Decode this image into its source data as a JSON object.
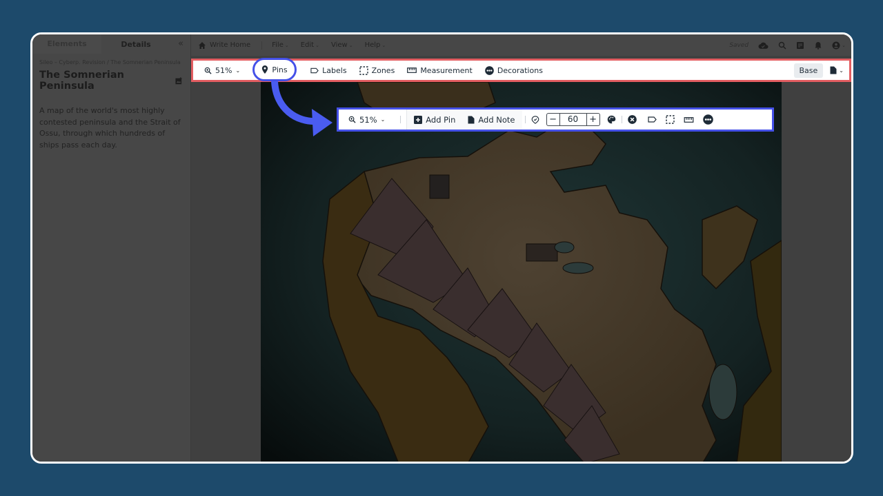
{
  "sidebar": {
    "tabs": [
      {
        "label": "Elements",
        "active": false
      },
      {
        "label": "Details",
        "active": true
      }
    ],
    "collapse_icon": "double-chevron-left-icon",
    "breadcrumb": "Sileo – Cyberp. Revision / The Somnerian Peninsula",
    "title": "The Somnerian Peninsula",
    "title_icon": "add-image-icon",
    "description": "A map of the world's most highly contested peninsula and the Strait of Ossu, through which hundreds of ships pass each day."
  },
  "menubar": {
    "home_label": "Write Home",
    "menus": [
      {
        "label": "File"
      },
      {
        "label": "Edit"
      },
      {
        "label": "View"
      },
      {
        "label": "Help"
      }
    ],
    "status": "Saved",
    "icons": [
      "cloud-check-icon",
      "search-icon",
      "notes-icon",
      "bell-icon",
      "account-icon"
    ]
  },
  "toolbar_main": {
    "zoom": "51%",
    "items": [
      {
        "label": "Pins",
        "icon": "map-pin-icon",
        "highlighted": true
      },
      {
        "label": "Labels",
        "icon": "label-tag-icon"
      },
      {
        "label": "Zones",
        "icon": "dashed-square-icon"
      },
      {
        "label": "Measurement",
        "icon": "ruler-icon"
      },
      {
        "label": "Decorations",
        "icon": "decorations-dots-icon"
      }
    ],
    "layer": "Base",
    "file_icon": "file-icon",
    "highlight_color": "#e35d61"
  },
  "toolbar_sub": {
    "zoom": "51%",
    "add_pin": "Add Pin",
    "add_note": "Add Note",
    "pin_size_value": "60",
    "decrement": "−",
    "increment": "+",
    "icons": [
      "pin-outline-icon",
      "palette-icon",
      "close-circle-icon",
      "label-tag-icon",
      "dashed-square-icon",
      "ruler-icon",
      "decorations-dots-icon"
    ],
    "highlight_color": "#4551e8"
  },
  "map": {
    "alt": "Somnerian Peninsula map"
  }
}
